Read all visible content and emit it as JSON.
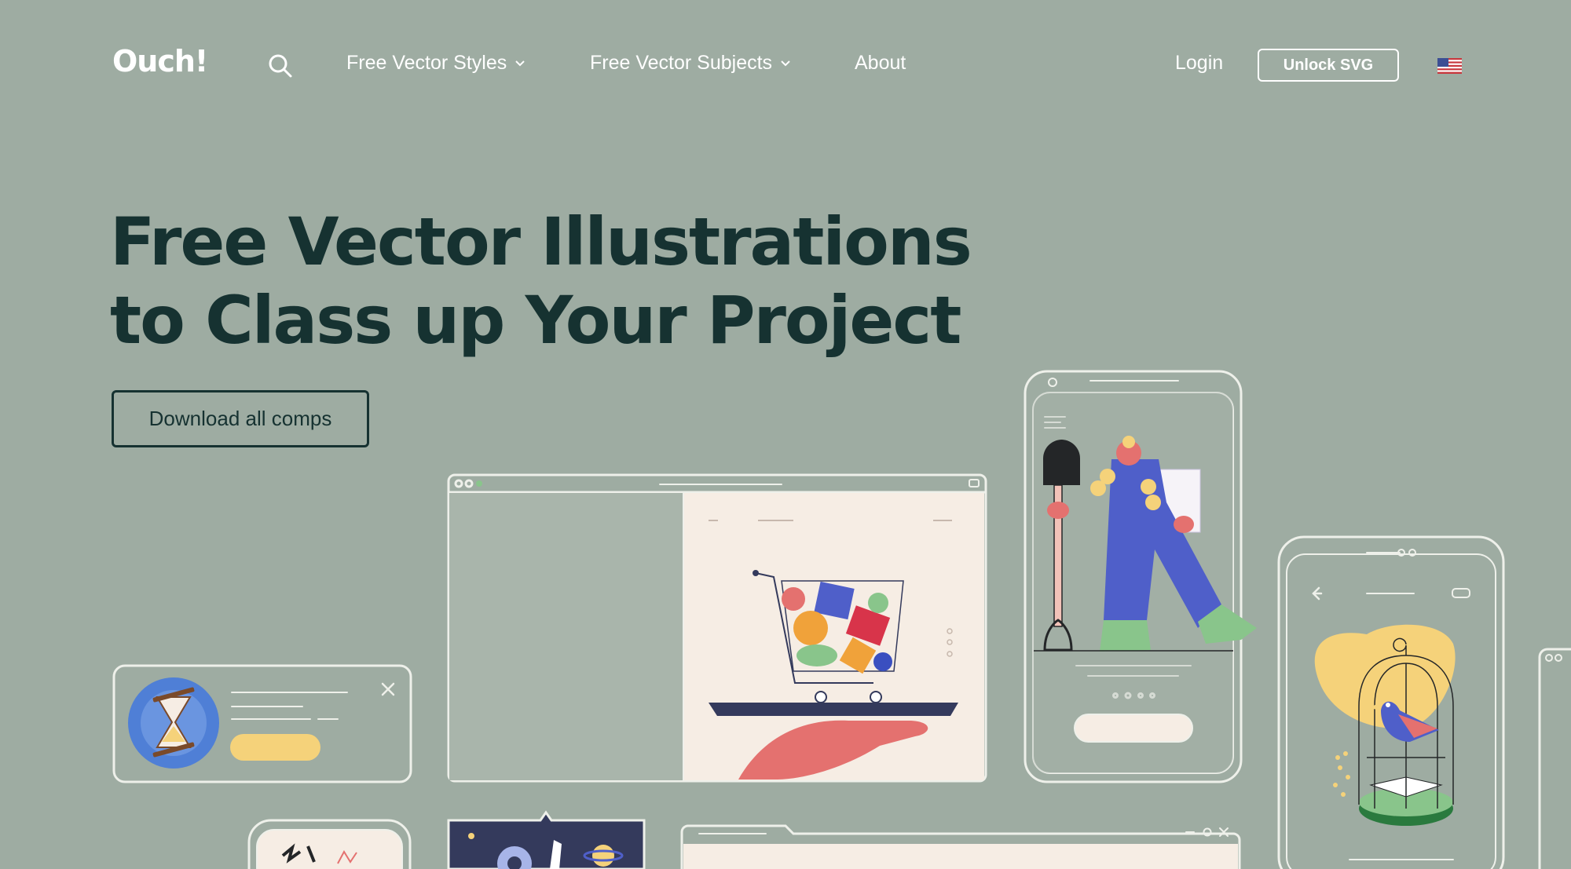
{
  "header": {
    "logo": "Ouch!",
    "nav": [
      {
        "label": "Free Vector Styles",
        "has_dropdown": true
      },
      {
        "label": "Free Vector Subjects",
        "has_dropdown": true
      },
      {
        "label": "About",
        "has_dropdown": false
      }
    ],
    "login_label": "Login",
    "unlock_label": "Unlock SVG",
    "language_icon": "us-flag-icon"
  },
  "hero": {
    "title_line1": "Free Vector Illustrations",
    "title_line2": "to Class up Your Project",
    "cta_label": "Download all comps"
  },
  "colors": {
    "background": "#9eaca2",
    "title": "#163231",
    "white": "#ffffff",
    "outline": "#eef0ea",
    "cream": "#f6ede4",
    "yellow": "#f5d27a",
    "blue": "#4f5fc9",
    "pink": "#e4716f",
    "green": "#89c58b",
    "navy": "#343a5c"
  }
}
